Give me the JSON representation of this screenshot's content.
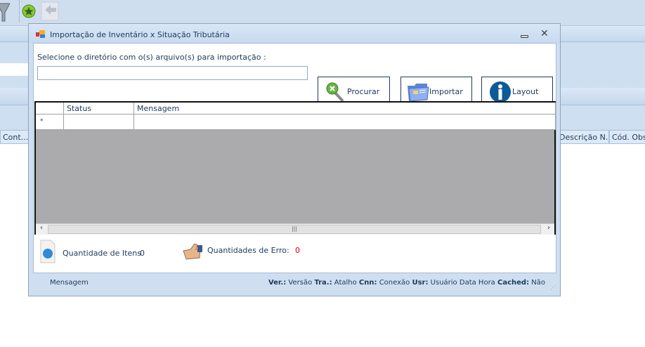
{
  "background": {
    "columns": [
      "Cont...",
      "Descrição N...",
      "Cód. Obse"
    ]
  },
  "dialog": {
    "title": "Importação de Inventário x Situação Tributária",
    "dir_label": "Selecione o diretório com o(s) arquivo(s) para importação :",
    "dir_value": "",
    "buttons": {
      "procurar": "Procurar",
      "importar": "Importar",
      "layout": "Layout"
    },
    "grid": {
      "columns": [
        "Status",
        "Mensagem"
      ],
      "new_row_marker": "*"
    },
    "counts": {
      "items_label": "Quantidade de Itens",
      "items_value": "0",
      "errors_label": "Quantidades de Erro:",
      "errors_value": "0"
    },
    "statusbar": {
      "message": "Mensagem",
      "ver_label": "Ver.:",
      "ver": "Versão",
      "tra_label": "Tra.:",
      "tra": "Atalho",
      "cnn_label": "Cnn:",
      "cnn": "Conexão",
      "usr_label": "Usr:",
      "usr": "Usuário",
      "datetime": "Data Hora",
      "cached_label": "Cached:",
      "cached": "Não"
    }
  },
  "colors": {
    "error": "#e00000",
    "accent": "#1e395b"
  }
}
